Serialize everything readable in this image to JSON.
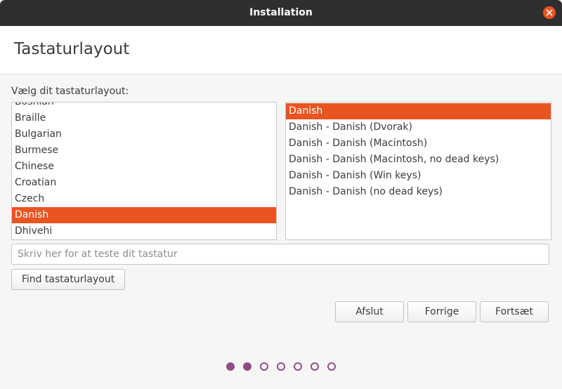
{
  "window": {
    "title": "Installation"
  },
  "header": {
    "title": "Tastaturlayout"
  },
  "prompt": "Vælg dit tastaturlayout:",
  "layouts": {
    "items": [
      "Bosnian",
      "Braille",
      "Bulgarian",
      "Burmese",
      "Chinese",
      "Croatian",
      "Czech",
      "Danish",
      "Dhivehi"
    ],
    "selected": "Danish"
  },
  "variants": {
    "items": [
      "Danish",
      "Danish - Danish (Dvorak)",
      "Danish - Danish (Macintosh)",
      "Danish - Danish (Macintosh, no dead keys)",
      "Danish - Danish (Win keys)",
      "Danish - Danish (no dead keys)"
    ],
    "selected": "Danish"
  },
  "test_field": {
    "placeholder": "Skriv her for at teste dit tastatur",
    "value": ""
  },
  "buttons": {
    "find": "Find tastaturlayout",
    "quit": "Afslut",
    "back": "Forrige",
    "next": "Fortsæt"
  },
  "progress": {
    "total_steps": 7,
    "completed_steps": 2
  },
  "colors": {
    "accent": "#e95420",
    "progress": "#924d8b",
    "titlebar": "#2f2f2f"
  }
}
